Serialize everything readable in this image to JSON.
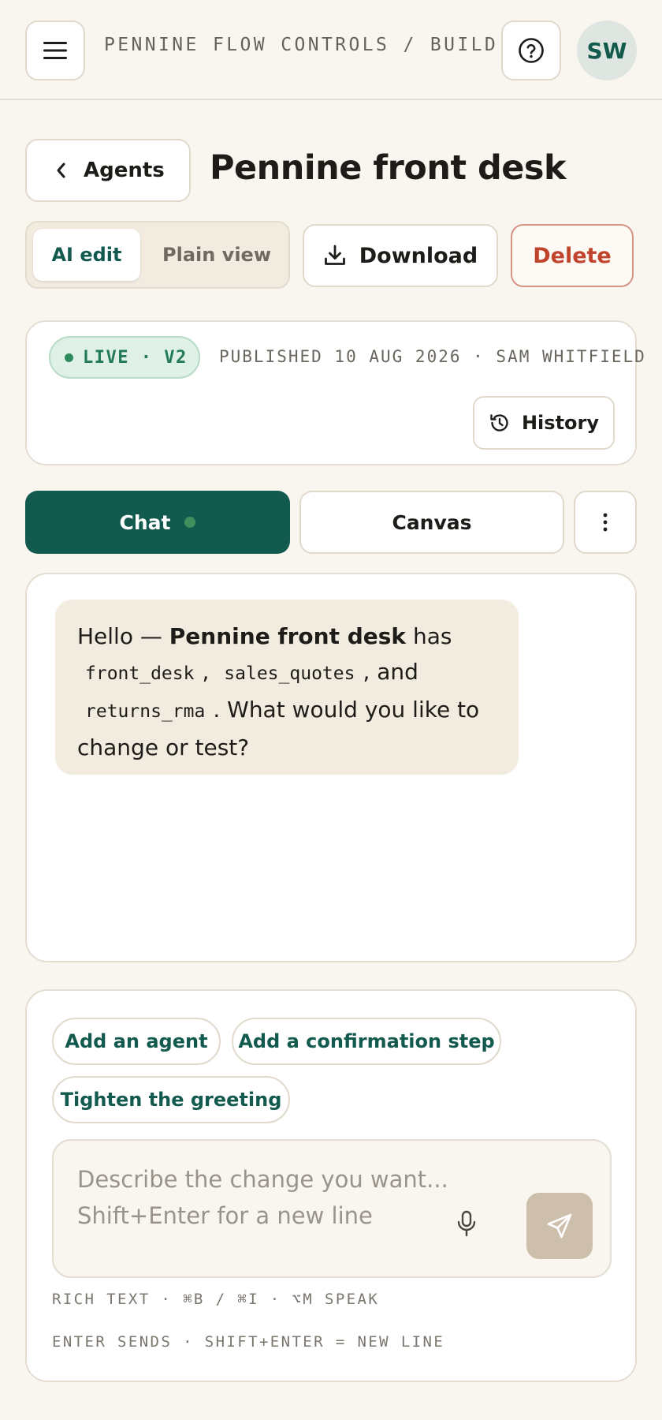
{
  "topbar": {
    "breadcrumb": "PENNINE FLOW CONTROLS / BUILD",
    "avatar_initials": "SW",
    "icons": [
      "menu-icon",
      "help-icon"
    ]
  },
  "title_row": {
    "back_label": "Agents",
    "page_title": "Pennine front desk"
  },
  "toolbar": {
    "segments": [
      {
        "label": "AI edit",
        "selected": true
      },
      {
        "label": "Plain view",
        "selected": false
      }
    ],
    "download_label": "Download",
    "delete_label": "Delete"
  },
  "status": {
    "badge": "LIVE · V2",
    "published": "PUBLISHED 10 AUG 2026 · SAM WHITFIELD",
    "history_label": "History"
  },
  "tabs": {
    "chat_label": "Chat",
    "canvas_label": "Canvas",
    "active": "Chat"
  },
  "chat": {
    "message": {
      "intro": "Hello — ",
      "agent_name": "Pennine front desk",
      "has": " has",
      "agents": [
        "front_desk",
        "sales_quotes",
        "returns_rma"
      ],
      "sep1": ",",
      "and": ", and",
      "tail": ". What would you like to change or test?"
    }
  },
  "composer": {
    "suggestions": [
      "Add an agent",
      "Add a confirmation step",
      "Tighten the greeting"
    ],
    "placeholder": "Describe the change you want...\nShift+Enter for a new line",
    "hint_line1": "RICH TEXT · ⌘B / ⌘I · ⌥M SPEAK",
    "hint_line2": "ENTER SENDS · SHIFT+ENTER = NEW LINE"
  },
  "colors": {
    "accent": "#12594e",
    "danger": "#c0432b",
    "live": "#227a56",
    "background": "#f9f6f0"
  }
}
